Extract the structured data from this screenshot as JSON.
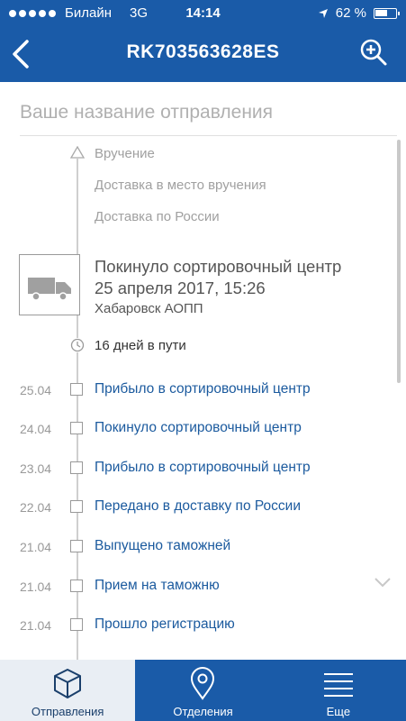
{
  "status_bar": {
    "carrier": "Билайн",
    "network": "3G",
    "time": "14:14",
    "battery": "62 %",
    "battery_level": 0.62
  },
  "nav": {
    "title": "RK703563628ES"
  },
  "name_field": {
    "placeholder": "Ваше название отправления",
    "value": ""
  },
  "future_steps": [
    "Вручение",
    "Доставка в место вручения",
    "Доставка по России"
  ],
  "current": {
    "status": "Покинуло сортировочный центр",
    "datetime": "25 апреля 2017, 15:26",
    "place": "Хабаровск АОПП",
    "days_in_transit": "16 дней в пути"
  },
  "events": [
    {
      "date": "25.04",
      "text": "Прибыло в сортировочный центр"
    },
    {
      "date": "24.04",
      "text": "Покинуло сортировочный центр"
    },
    {
      "date": "23.04",
      "text": "Прибыло в сортировочный центр"
    },
    {
      "date": "22.04",
      "text": "Передано в доставку по России"
    },
    {
      "date": "21.04",
      "text": "Выпущено таможней"
    },
    {
      "date": "21.04",
      "text": "Прием на таможню"
    },
    {
      "date": "21.04",
      "text": "Прошло регистрацию"
    }
  ],
  "tabs": [
    {
      "label": "Отправления",
      "icon": "box-icon",
      "active": true
    },
    {
      "label": "Отделения",
      "icon": "location-pin-icon",
      "active": false
    },
    {
      "label": "Еще",
      "icon": "menu-icon",
      "active": false
    }
  ],
  "colors": {
    "brand": "#1a5ba8",
    "link": "#1b5a9e",
    "active_tab_bg": "#e9eef4"
  }
}
